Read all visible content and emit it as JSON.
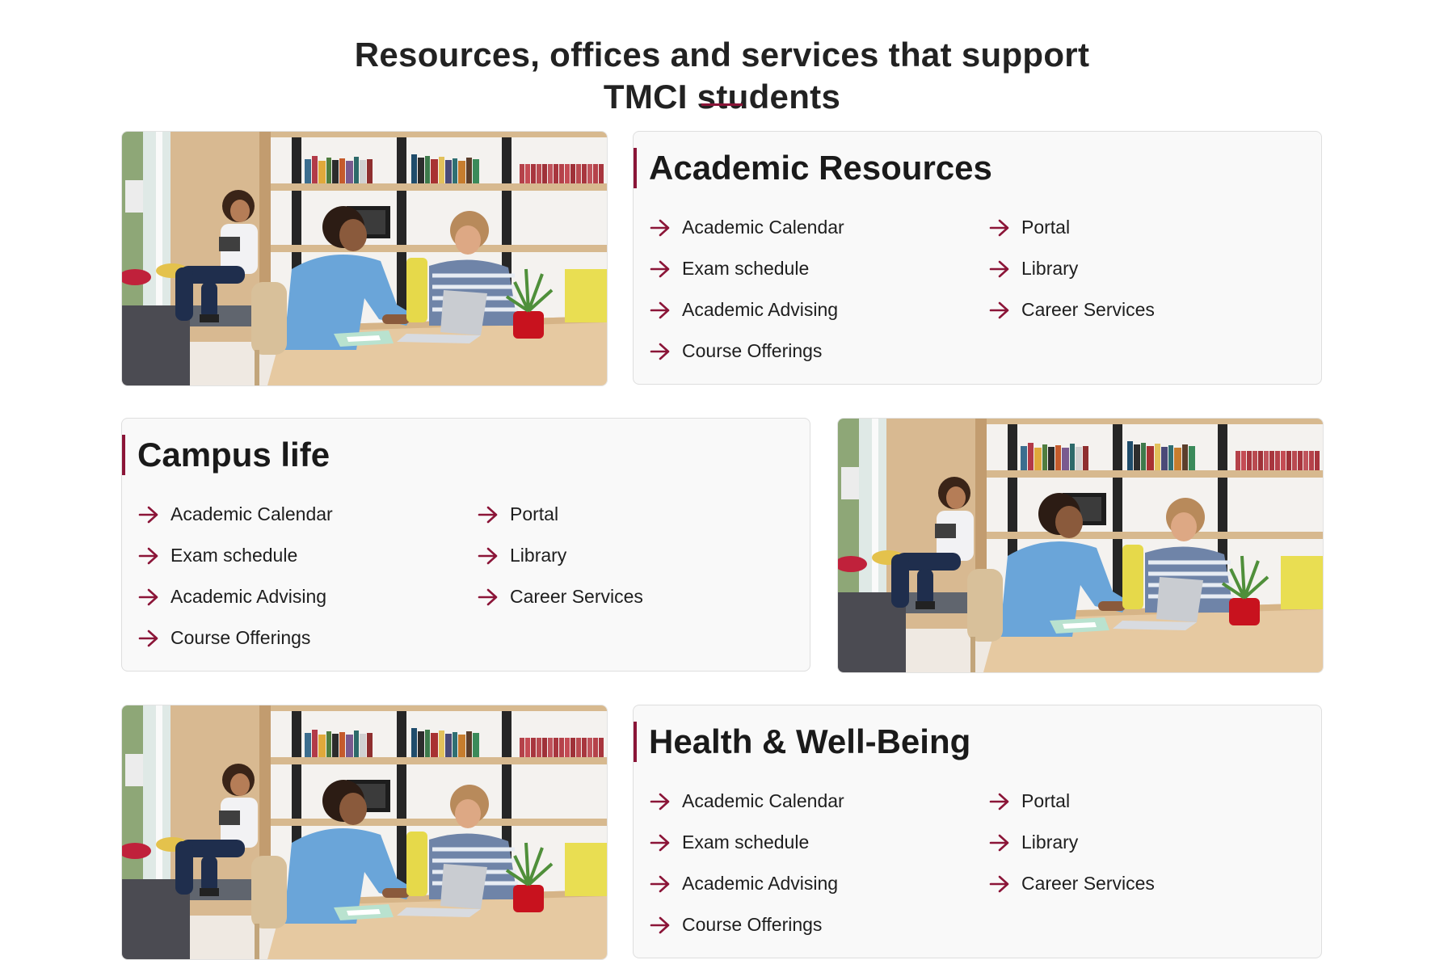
{
  "header": {
    "title_line1": "Resources, offices and services that support",
    "title_line2": "TMCI students"
  },
  "theme": {
    "accent": "#8b1538",
    "card_background": "#f9f9f9",
    "card_border": "#dedede"
  },
  "sections": [
    {
      "title": "Academic Resources",
      "image": "students-in-library-photo",
      "links_col1": [
        "Academic Calendar",
        "Exam schedule",
        "Academic Advising",
        "Course Offerings"
      ],
      "links_col2": [
        "Portal",
        "Library",
        "Career Services"
      ]
    },
    {
      "title": "Campus life",
      "image": "students-in-library-photo",
      "links_col1": [
        "Academic Calendar",
        "Exam schedule",
        "Academic Advising",
        "Course Offerings"
      ],
      "links_col2": [
        "Portal",
        "Library",
        "Career Services"
      ]
    },
    {
      "title": "Health & Well-Being",
      "image": "students-in-library-photo",
      "links_col1": [
        "Academic Calendar",
        "Exam schedule",
        "Academic Advising",
        "Course Offerings"
      ],
      "links_col2": [
        "Portal",
        "Library",
        "Career Services"
      ]
    }
  ],
  "icons": {
    "link_arrow": "arrow-right-icon"
  }
}
